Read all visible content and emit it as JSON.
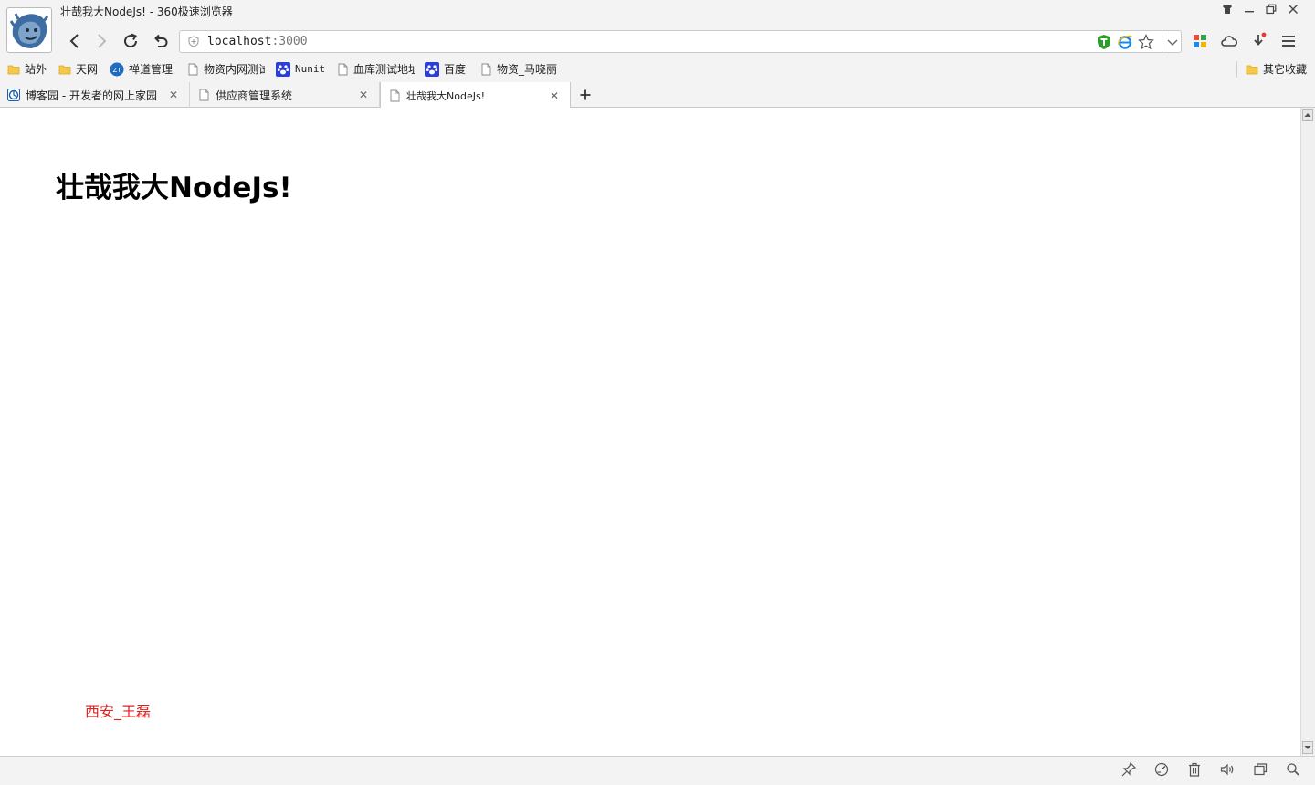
{
  "window": {
    "title": "壮哉我大NodeJs! - 360极速浏览器",
    "controls": {
      "skin": "skin-icon",
      "minimize": "minimize-icon",
      "restore": "restore-icon",
      "close": "close-icon"
    }
  },
  "address_bar": {
    "host": "localhost",
    "port": ":3000"
  },
  "bookmarks": [
    {
      "label": "站外",
      "icon": "folder-icon"
    },
    {
      "label": "天网",
      "icon": "folder-icon"
    },
    {
      "label": "禅道管理",
      "icon": "zentao-icon"
    },
    {
      "label": "物资内网测试",
      "icon": "page-icon"
    },
    {
      "label": "Nunit",
      "icon": "paw-icon"
    },
    {
      "label": "血库测试地址",
      "icon": "page-icon"
    },
    {
      "label": "百度",
      "icon": "paw-icon"
    },
    {
      "label": "物资_马晓丽",
      "icon": "page-icon"
    }
  ],
  "other_bookmarks": {
    "label": "其它收藏"
  },
  "tabs": [
    {
      "label": "博客园 - 开发者的网上家园",
      "active": false
    },
    {
      "label": "供应商管理系统",
      "active": false
    },
    {
      "label": "壮哉我大NodeJs!",
      "active": true
    }
  ],
  "page": {
    "heading": "壮哉我大NodeJs!",
    "footer": "西安_王磊"
  },
  "colors": {
    "chrome": "#f3f3f3",
    "footer_text": "#dd2222",
    "shield_green": "#2a9d2a",
    "ie_blue": "#1e88e5"
  }
}
